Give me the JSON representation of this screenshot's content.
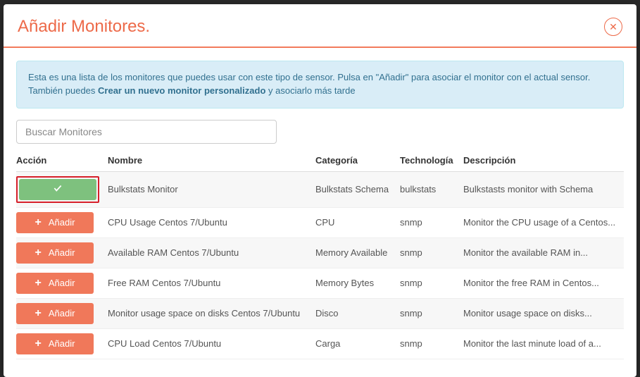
{
  "modal": {
    "title": "Añadir Monitores."
  },
  "info": {
    "line1": "Esta es una lista de los monitores que puedes usar con este tipo de sensor. Pulsa en \"Añadir\" para asociar el monitor con el actual sensor.",
    "line2_pre": "También puedes ",
    "line2_strong": "Crear un nuevo monitor personalizado",
    "line2_post": " y asociarlo más tarde"
  },
  "search": {
    "placeholder": "Buscar Monitores"
  },
  "table": {
    "headers": {
      "action": "Acción",
      "name": "Nombre",
      "category": "Categoría",
      "technology": "Technología",
      "description": "Descripción"
    },
    "add_label": "Añadir",
    "rows": [
      {
        "added": true,
        "name": "Bulkstats Monitor",
        "category": "Bulkstats Schema",
        "technology": "bulkstats",
        "description": "Bulkstasts monitor with Schema"
      },
      {
        "added": false,
        "name": "CPU Usage Centos 7/Ubuntu",
        "category": "CPU",
        "technology": "snmp",
        "description": "Monitor the CPU usage of a Centos..."
      },
      {
        "added": false,
        "name": "Available RAM Centos 7/Ubuntu",
        "category": "Memory Available",
        "technology": "snmp",
        "description": "Monitor the available RAM in..."
      },
      {
        "added": false,
        "name": "Free RAM Centos 7/Ubuntu",
        "category": "Memory Bytes",
        "technology": "snmp",
        "description": "Monitor the free RAM in Centos..."
      },
      {
        "added": false,
        "name": "Monitor usage space on disks Centos 7/Ubuntu",
        "category": "Disco",
        "technology": "snmp",
        "description": "Monitor usage space on disks..."
      },
      {
        "added": false,
        "name": "CPU Load Centos 7/Ubuntu",
        "category": "Carga",
        "technology": "snmp",
        "description": "Monitor the last minute load of a..."
      }
    ]
  }
}
